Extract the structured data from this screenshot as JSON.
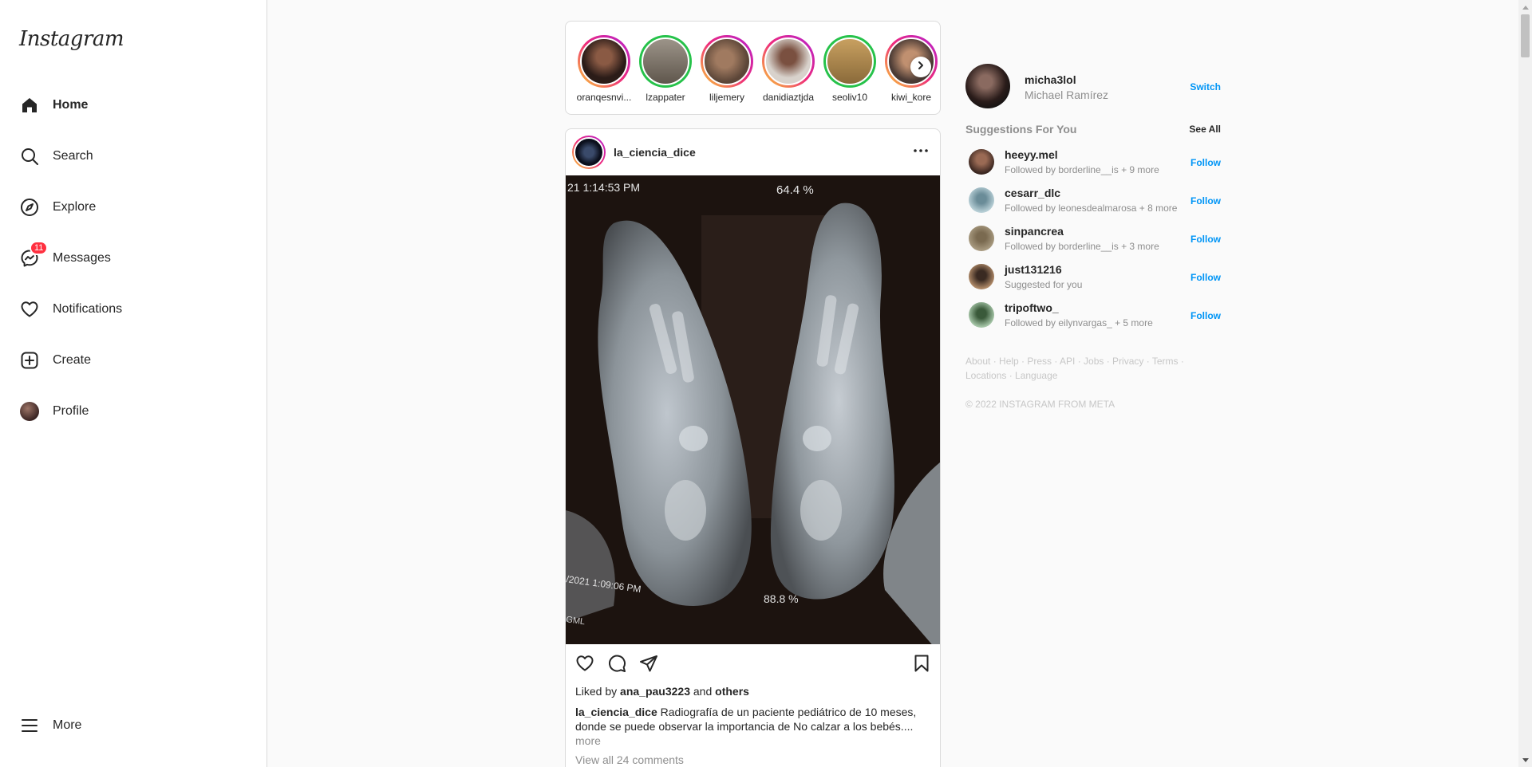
{
  "app": {
    "logo": "Instagram"
  },
  "sidebar": {
    "items": [
      {
        "label": "Home",
        "icon": "home-icon",
        "active": true
      },
      {
        "label": "Search",
        "icon": "search-icon"
      },
      {
        "label": "Explore",
        "icon": "compass-icon"
      },
      {
        "label": "Messages",
        "icon": "messenger-icon",
        "badge": "11"
      },
      {
        "label": "Notifications",
        "icon": "heart-icon"
      },
      {
        "label": "Create",
        "icon": "plus-square-icon"
      },
      {
        "label": "Profile",
        "icon": "avatar"
      }
    ],
    "more_label": "More"
  },
  "stories": [
    {
      "name": "oranqesnvi...",
      "ring": "gradient"
    },
    {
      "name": "lzappater",
      "ring": "green"
    },
    {
      "name": "liljemery",
      "ring": "gradient"
    },
    {
      "name": "danidiaztjda",
      "ring": "gradient"
    },
    {
      "name": "seoliv10",
      "ring": "green"
    },
    {
      "name": "kiwi_kore",
      "ring": "gradient"
    }
  ],
  "post": {
    "username": "la_ciencia_dice",
    "image_texts": {
      "top_time": "21 1:14:53 PM",
      "top_pct": "64.4 %",
      "bottom_time": "/2021 1:09:06 PM",
      "bottom_pct": "88.8 %",
      "corner": "GML"
    },
    "liked_by_prefix": "Liked by",
    "liked_by_user": "ana_pau3223",
    "liked_by_and": "and",
    "liked_by_others": "others",
    "caption_user": "la_ciencia_dice",
    "caption_text": "Radiografía de un paciente pediátrico de 10 meses, donde se puede observar la importancia de No calzar a los bebés....",
    "caption_more": "more",
    "comments_link": "View all 24 comments"
  },
  "me": {
    "username": "micha3lol",
    "name": "Michael Ramírez",
    "switch_label": "Switch"
  },
  "suggestions": {
    "title": "Suggestions For You",
    "see_all": "See All",
    "follow_label": "Follow",
    "items": [
      {
        "username": "heeyy.mel",
        "sub": "Followed by borderline__is + 9 more"
      },
      {
        "username": "cesarr_dlc",
        "sub": "Followed by leonesdealmarosa + 8 more"
      },
      {
        "username": "sinpancrea",
        "sub": "Followed by borderline__is + 3 more"
      },
      {
        "username": "just131216",
        "sub": "Suggested for you"
      },
      {
        "username": "tripoftwo_",
        "sub": "Followed by eilynvargas_ + 5 more"
      }
    ]
  },
  "footer": {
    "links": "About · Help · Press · API · Jobs · Privacy · Terms · Locations · Language",
    "copyright": "© 2022 INSTAGRAM FROM META"
  },
  "colors": {
    "accent": "#0095f6",
    "badge": "#ff3040",
    "muted": "#8e8e8e"
  }
}
